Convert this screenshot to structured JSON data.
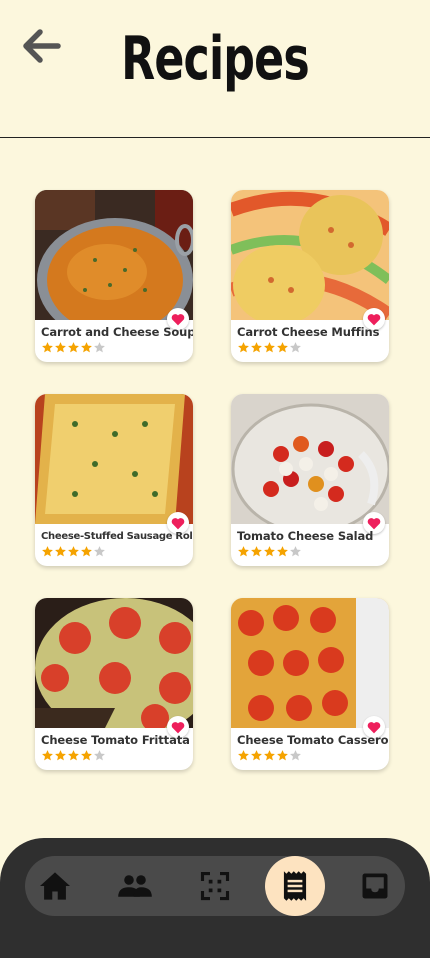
{
  "header": {
    "title": "Recipes",
    "back_icon": "arrow-back-icon"
  },
  "recipes": [
    {
      "name": "Carrot and Cheese Soup",
      "rating": 4,
      "favorite": true
    },
    {
      "name": "Carrot Cheese Muffins",
      "rating": 4,
      "favorite": true
    },
    {
      "name": "Cheese-Stuffed Sausage Rolls",
      "rating": 4,
      "favorite": true
    },
    {
      "name": "Tomato Cheese Salad",
      "rating": 4,
      "favorite": true
    },
    {
      "name": "Cheese Tomato Frittata",
      "rating": 4,
      "favorite": true
    },
    {
      "name": "Cheese Tomato Casserole",
      "rating": 4,
      "favorite": true
    }
  ],
  "nav": {
    "items": [
      "home-icon",
      "people-icon",
      "scan-icon",
      "receipt-icon",
      "inbox-icon"
    ],
    "active": "receipt-icon"
  },
  "colors": {
    "background": "#fcf7dd",
    "star": "#f5a300",
    "heart": "#ee1f5c",
    "nav": "#2f2f2f",
    "active": "#fde3c0"
  }
}
